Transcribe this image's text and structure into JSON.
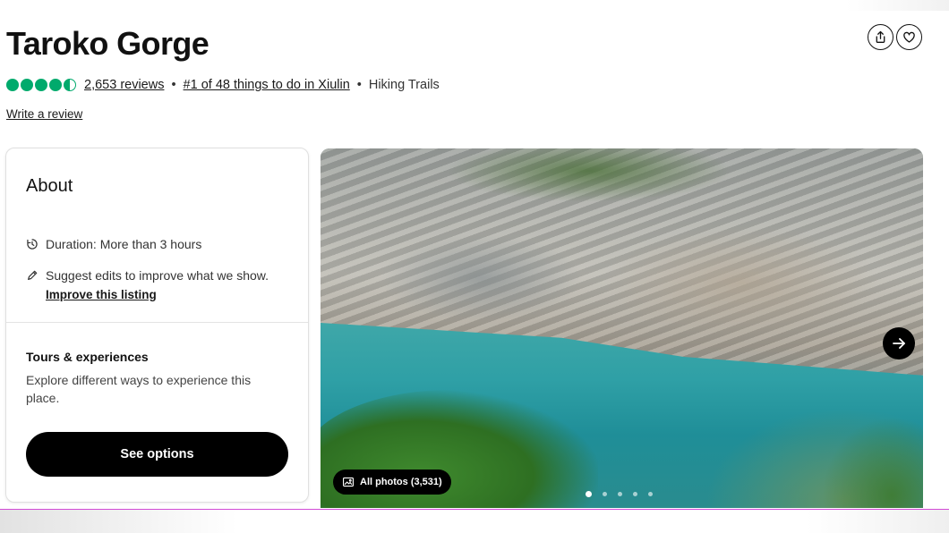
{
  "attraction": {
    "title": "Taroko Gorge"
  },
  "rating": {
    "bubbles_filled": 4.5,
    "bubbles_total": 5,
    "reviews_text": "2,653 reviews",
    "rank_text": "#1 of 48 things to do in Xiulin",
    "category": "Hiking Trails",
    "separator": "•"
  },
  "actions": {
    "write_review": "Write a review",
    "share_icon": "share-icon",
    "save_icon": "heart-icon"
  },
  "about": {
    "title": "About",
    "duration": "Duration: More than 3 hours",
    "suggest": "Suggest edits to improve what we show.",
    "improve_link": "Improve this listing",
    "tours_title": "Tours & experiences",
    "tours_desc": "Explore different ways to experience this place.",
    "see_options": "See options"
  },
  "gallery": {
    "all_photos": "All photos (3,531)",
    "dots_total": 5,
    "active_dot": 1
  },
  "colors": {
    "rating_green": "#00aa6c",
    "button_black": "#000000"
  }
}
